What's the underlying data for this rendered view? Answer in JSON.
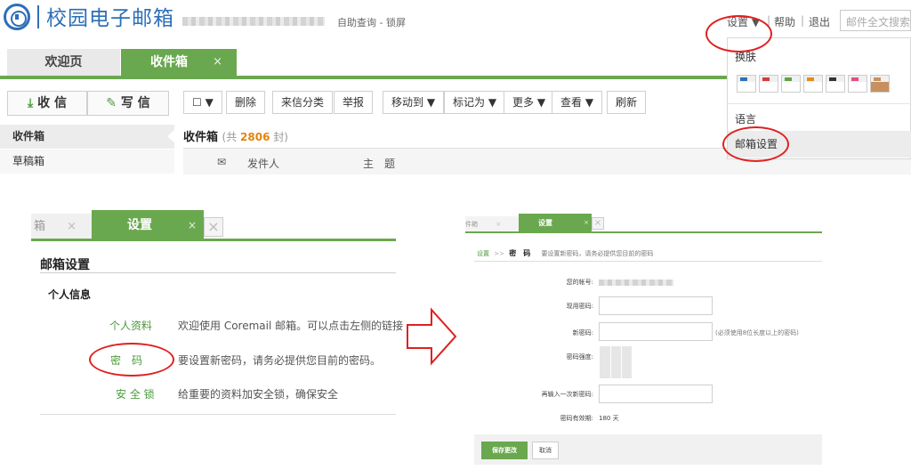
{
  "header": {
    "logo_text": "校园电子邮箱",
    "self_help": "自助查询 - 锁屏",
    "settings_label": "设置 ▼",
    "sep1": "|",
    "help_label": "帮助",
    "sep2": "|",
    "logout_label": "退出",
    "search_placeholder": "邮件全文搜索"
  },
  "tabs": {
    "welcome": "欢迎页",
    "inbox": "收件箱",
    "close": "×"
  },
  "sidebar": {
    "receive_label": "收 信",
    "write_label": "写 信",
    "items": [
      {
        "label": "收件箱"
      },
      {
        "label": "草稿箱"
      }
    ]
  },
  "toolbar": {
    "checkbox_arrow": "▼",
    "delete": "删除",
    "classify": "来信分类",
    "report": "举报",
    "move_to": "移动到 ▼",
    "mark_as": "标记为 ▼",
    "more": "更多 ▼",
    "view": "查看 ▼",
    "refresh": "刷新"
  },
  "inbox": {
    "title": "收件箱",
    "count_prefix": "(共 ",
    "count": "2806",
    "count_suffix": " 封)",
    "col_sender": "发件人",
    "col_subject": "主　题"
  },
  "settings_menu": {
    "skin_label": "换肤",
    "language_label": "语言",
    "mailbox_settings_label": "邮箱设置",
    "skin_colors": [
      "#2d6fb7",
      "#d83a3a",
      "#5aa83c",
      "#e88a1a",
      "#333333",
      "#e84a8a",
      "#c89060"
    ]
  },
  "settings_page": {
    "prev_tab": "箱",
    "prev_close": "×",
    "tab_label": "设置",
    "tab_close": "×",
    "close_box": "×",
    "title": "邮箱设置",
    "section": "个人信息",
    "rows": [
      {
        "link": "个人资料",
        "desc": "欢迎使用 Coremail 邮箱。可以点击左侧的链接"
      },
      {
        "link": "密　码",
        "desc": "要设置新密码，请务必提供您目前的密码。"
      },
      {
        "link": "安 全 锁",
        "desc": "给重要的资料加安全锁，确保安全"
      }
    ]
  },
  "password_page": {
    "prev_tab": "件箱",
    "prev_close": "×",
    "tab_label": "设置",
    "tab_close": "×",
    "close_box": "×",
    "crumb_link": "设置",
    "crumb_sep": ">>",
    "crumb_current": "密　码",
    "crumb_hint": "要设置新密码，请务必提供您目前的密码",
    "account_label": "您的帐号:",
    "current_pw_label": "现用密码:",
    "new_pw_label": "新密码:",
    "new_pw_hint": "(必须使用8位长度以上的密码)",
    "strength_label": "密码强度:",
    "confirm_label": "再输入一次新密码:",
    "validity_label": "密码有效期:",
    "validity_value": "180 天",
    "save_label": "保存更改",
    "cancel_label": "取消"
  },
  "colors": {
    "accent_green": "#6aa84f",
    "logo_blue": "#2d6fb7",
    "annotation_red": "#e02020",
    "count_orange": "#e8820a"
  }
}
